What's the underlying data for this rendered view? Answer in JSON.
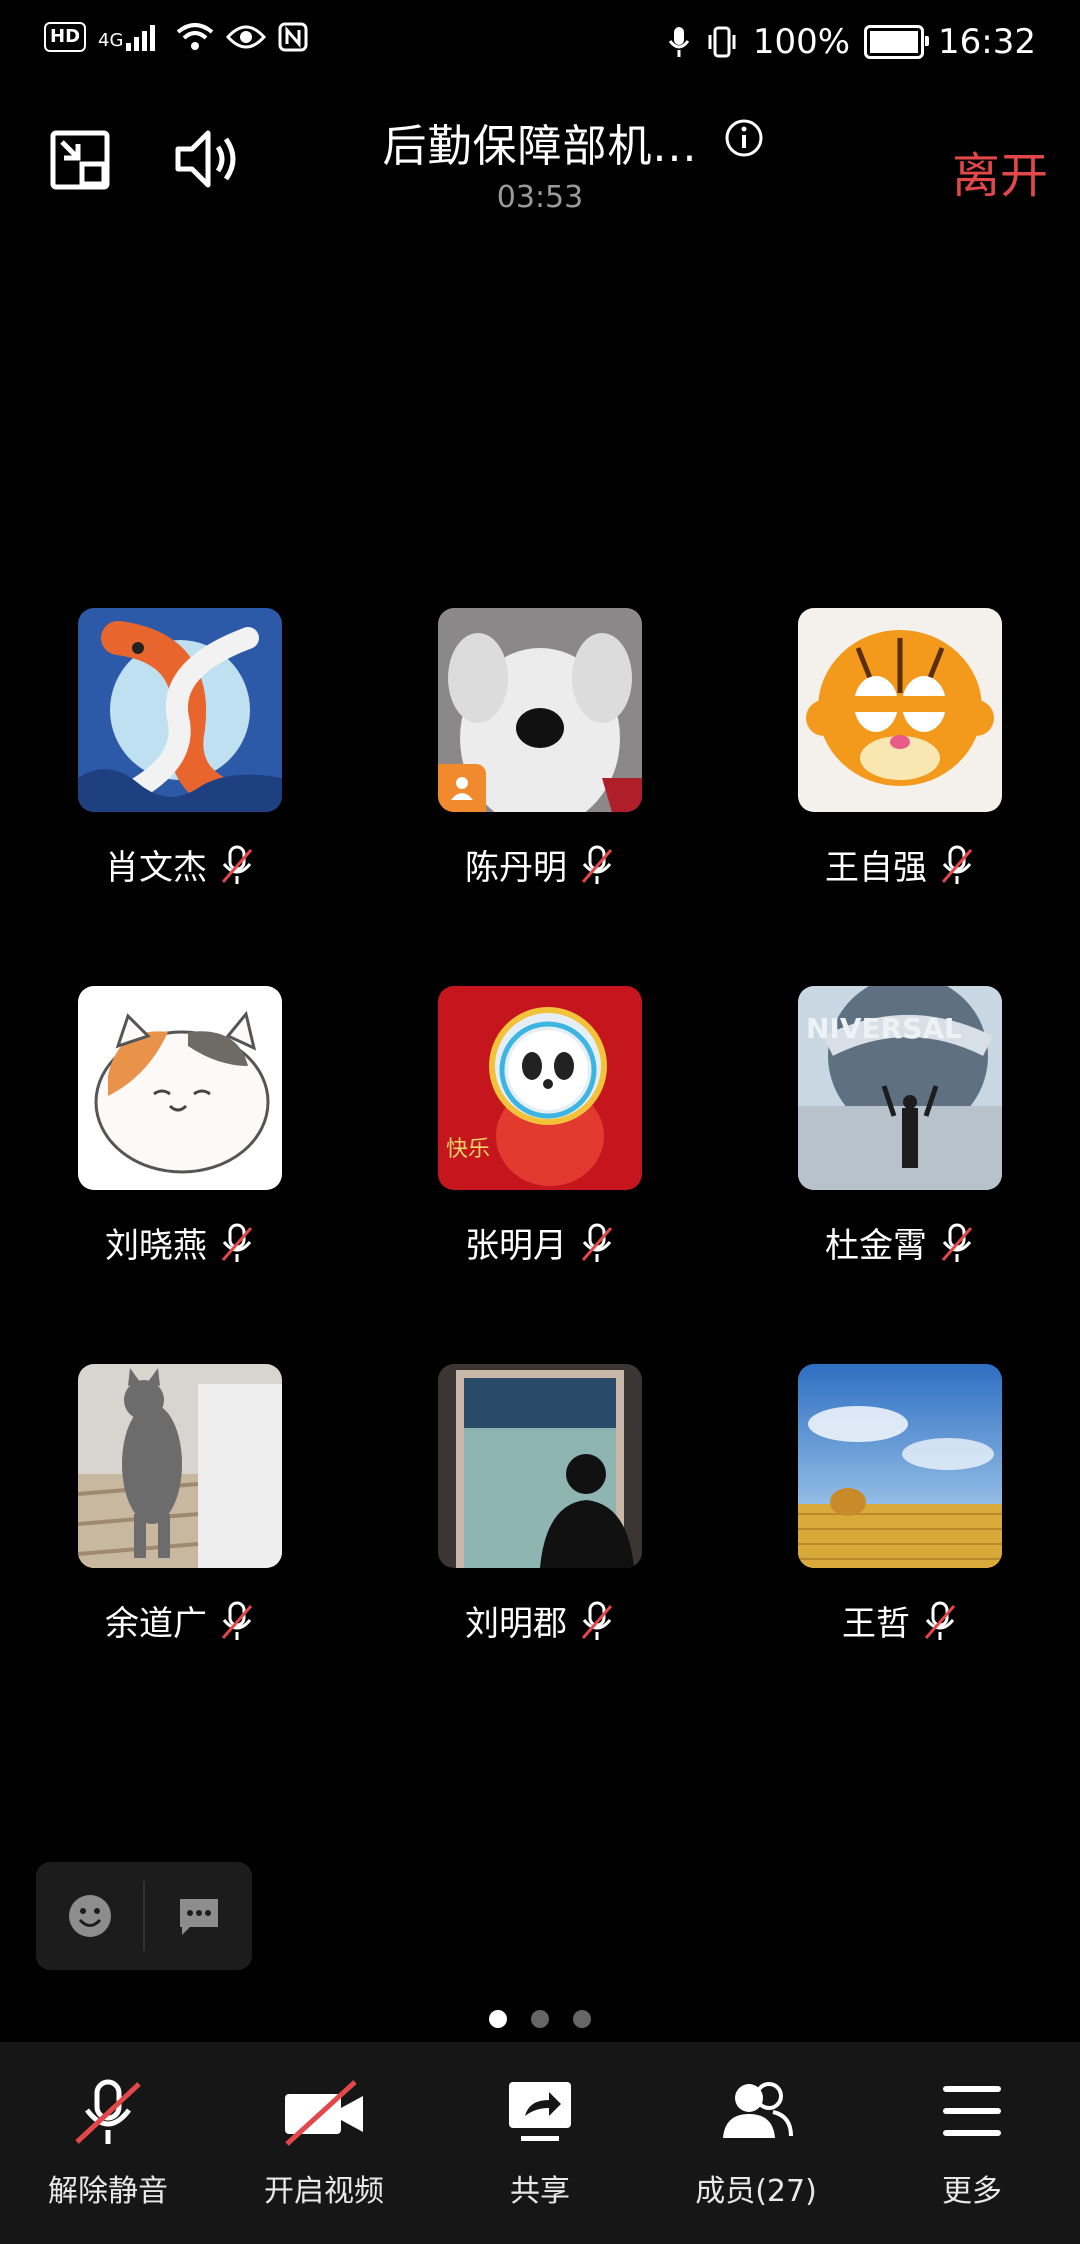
{
  "status_bar": {
    "hd": "HD",
    "network": "4G",
    "battery": "100%",
    "time": "16:32"
  },
  "header": {
    "title": "后勤保障部机...",
    "timer": "03:53",
    "leave_label": "离开"
  },
  "participants": [
    {
      "name": "肖文杰",
      "muted": true,
      "avatar": "koi-fish-art"
    },
    {
      "name": "陈丹明",
      "muted": true,
      "avatar": "plush-dog",
      "badge": "host-icon"
    },
    {
      "name": "王自强",
      "muted": true,
      "avatar": "garfield"
    },
    {
      "name": "刘晓燕",
      "muted": true,
      "avatar": "cartoon-cat"
    },
    {
      "name": "张明月",
      "muted": true,
      "avatar": "panda-mascot"
    },
    {
      "name": "杜金霄",
      "muted": true,
      "avatar": "universal-globe"
    },
    {
      "name": "余道广",
      "muted": true,
      "avatar": "grey-cat"
    },
    {
      "name": "刘明郡",
      "muted": true,
      "avatar": "person-at-window"
    },
    {
      "name": "王哲",
      "muted": true,
      "avatar": "wheat-field-sky"
    }
  ],
  "pagination": {
    "pages": 3,
    "current": 1
  },
  "toolbar": {
    "unmute": "解除静音",
    "video": "开启视频",
    "share": "共享",
    "members": "成员(27)",
    "more": "更多"
  },
  "colors": {
    "accent_red": "#e2474a",
    "background": "#000000",
    "toolbar": "#161616"
  }
}
